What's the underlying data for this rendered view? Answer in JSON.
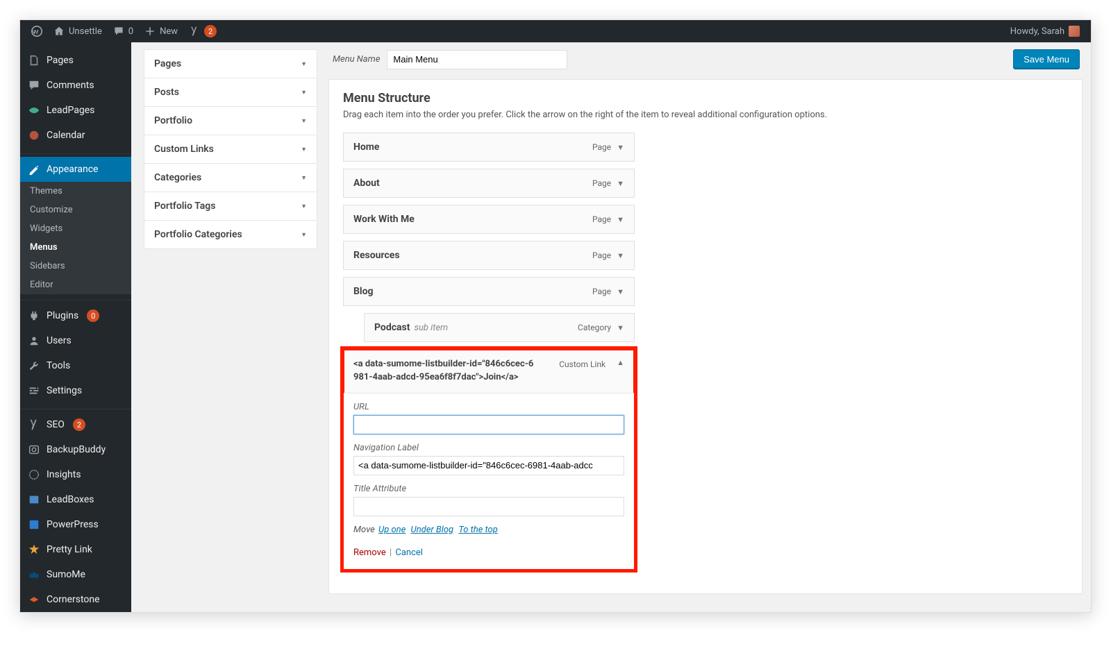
{
  "adminbar": {
    "site_name": "Unsettle",
    "comments_count": "0",
    "new_label": "New",
    "yoast_badge": "2",
    "howdy": "Howdy, Sarah"
  },
  "sidebar": {
    "items": [
      {
        "name": "pages",
        "label": "Pages"
      },
      {
        "name": "comments",
        "label": "Comments"
      },
      {
        "name": "leadpages",
        "label": "LeadPages"
      },
      {
        "name": "calendar",
        "label": "Calendar"
      }
    ],
    "appearance": {
      "label": "Appearance",
      "sub": [
        {
          "name": "themes",
          "label": "Themes"
        },
        {
          "name": "customize",
          "label": "Customize"
        },
        {
          "name": "widgets",
          "label": "Widgets"
        },
        {
          "name": "menus",
          "label": "Menus",
          "active": true
        },
        {
          "name": "sidebars",
          "label": "Sidebars"
        },
        {
          "name": "editor",
          "label": "Editor"
        }
      ]
    },
    "items2": [
      {
        "name": "plugins",
        "label": "Plugins",
        "badge": "0"
      },
      {
        "name": "users",
        "label": "Users"
      },
      {
        "name": "tools",
        "label": "Tools"
      },
      {
        "name": "settings",
        "label": "Settings"
      }
    ],
    "items3": [
      {
        "name": "seo",
        "label": "SEO",
        "badge": "2"
      },
      {
        "name": "backupbuddy",
        "label": "BackupBuddy"
      },
      {
        "name": "insights",
        "label": "Insights"
      },
      {
        "name": "leadboxes",
        "label": "LeadBoxes"
      },
      {
        "name": "powerpress",
        "label": "PowerPress"
      },
      {
        "name": "prettylink",
        "label": "Pretty Link"
      },
      {
        "name": "sumome",
        "label": "SumoMe"
      },
      {
        "name": "cornerstone",
        "label": "Cornerstone"
      }
    ]
  },
  "metaboxes": [
    "Pages",
    "Posts",
    "Portfolio",
    "Custom Links",
    "Categories",
    "Portfolio Tags",
    "Portfolio Categories"
  ],
  "menu": {
    "name_label": "Menu Name",
    "name_value": "Main Menu",
    "save_label": "Save Menu",
    "structure_heading": "Menu Structure",
    "structure_help": "Drag each item into the order you prefer. Click the arrow on the right of the item to reveal additional configuration options.",
    "items": [
      {
        "title": "Home",
        "type": "Page"
      },
      {
        "title": "About",
        "type": "Page"
      },
      {
        "title": "Work With Me",
        "type": "Page"
      },
      {
        "title": "Resources",
        "type": "Page"
      },
      {
        "title": "Blog",
        "type": "Page"
      },
      {
        "title": "Podcast",
        "type": "Category",
        "sub": "sub item",
        "indent": true
      }
    ],
    "custom": {
      "title": "<a data-sumome-listbuilder-id=\"846c6cec-6981-4aab-adcd-95ea6f8f7dac\">Join</a>",
      "type": "Custom Link",
      "url_label": "URL",
      "url_value": "",
      "nav_label_label": "Navigation Label",
      "nav_label_value": "<a data-sumome-listbuilder-id=\"846c6cec-6981-4aab-adcc",
      "title_attr_label": "Title Attribute",
      "title_attr_value": "",
      "move_label": "Move",
      "move_up": "Up one",
      "move_under": "Under Blog",
      "move_top": "To the top",
      "remove_label": "Remove",
      "cancel_label": "Cancel"
    }
  }
}
